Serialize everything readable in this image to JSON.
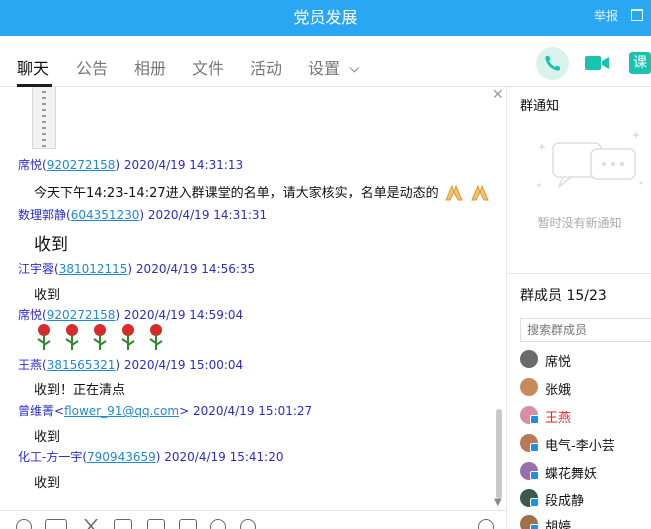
{
  "window": {
    "title": "党员发展",
    "report_label": "举报"
  },
  "tabs": [
    {
      "label": "聊天",
      "active": true
    },
    {
      "label": "公告"
    },
    {
      "label": "相册"
    },
    {
      "label": "文件"
    },
    {
      "label": "活动"
    },
    {
      "label": "设置"
    }
  ],
  "header_actions": {
    "class_label": "课"
  },
  "messages": [
    {
      "name": "席悦",
      "qq": "920272158",
      "time": "2020/4/19 14:31:13",
      "text": "今天下午14:23-14:27进入群课堂的名单，请大家核实，名单是动态的"
    },
    {
      "name": "数理郭静",
      "qq": "604351230",
      "time": "2020/4/19 14:31:31",
      "text": "收到"
    },
    {
      "name": "江宇蓉",
      "qq": "381012115",
      "time": "2020/4/19 14:56:35",
      "text": "收到"
    },
    {
      "name": "席悦",
      "qq": "920272158",
      "time": "2020/4/19 14:59:04",
      "text": ""
    },
    {
      "name": "王燕",
      "qq": "381565321",
      "time": "2020/4/19 15:00:04",
      "text": "收到！正在清点"
    },
    {
      "name": "曾维菁",
      "qq": "flower_91@qq.com",
      "time": "2020/4/19 15:01:27",
      "text": "收到"
    },
    {
      "name": "化工-方一宇",
      "qq": "790943659",
      "time": "2020/4/19 15:41:20",
      "text": "收到"
    }
  ],
  "notice": {
    "title": "群通知",
    "empty_text": "暂时没有新通知"
  },
  "members": {
    "title": "群成员 15/23",
    "search_placeholder": "搜索群成员",
    "list": [
      {
        "name": "席悦",
        "color": "#6b6b6b",
        "badge": false,
        "highlight": false
      },
      {
        "name": "张娥",
        "color": "#c98a5a",
        "badge": false,
        "highlight": false
      },
      {
        "name": "王燕",
        "color": "#d88fa0",
        "badge": true,
        "highlight": true
      },
      {
        "name": "电气-李小芸",
        "color": "#b8795a",
        "badge": true,
        "highlight": false
      },
      {
        "name": "蝶花舞妖",
        "color": "#9a6fb0",
        "badge": true,
        "highlight": false
      },
      {
        "name": "段成静",
        "color": "#3c5a4a",
        "badge": true,
        "highlight": false
      },
      {
        "name": "胡婷",
        "color": "#a0704a",
        "badge": true,
        "highlight": false
      }
    ]
  },
  "colors": {
    "titlebar": "#2aa7f3",
    "sender": "#2a2ad8",
    "qq_link": "#1e87e0",
    "call_green": "#19c3b0",
    "highlight_name": "#e22222"
  }
}
